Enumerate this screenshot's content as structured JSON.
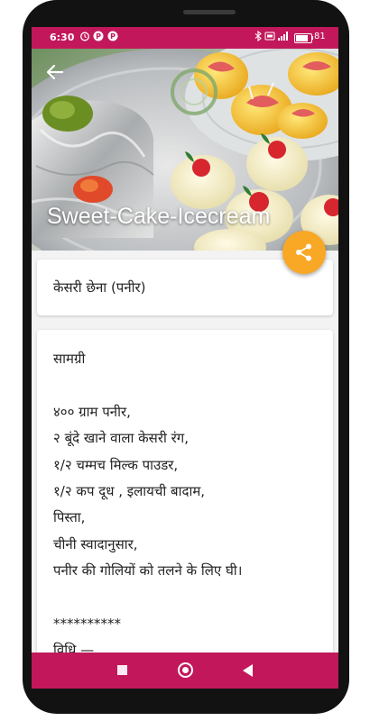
{
  "status_bar": {
    "time": "6:30",
    "icons": [
      "alarm-icon",
      "p-app-icon",
      "p-app-icon",
      "bluetooth-icon",
      "volte-icon",
      "signal-icon",
      "battery-icon"
    ],
    "battery_text": "81",
    "battery_level": 0.81
  },
  "header": {
    "app_title": "Sweet-Cake-Icecream"
  },
  "recipe": {
    "title": "केसरी छेना (पनीर)",
    "lines": [
      "सामग्री",
      "",
      "४०० ग्राम पनीर,",
      "२ बूंदे खाने वाला केसरी रंग,",
      "१/२ चम्मच मिल्क पाउडर,",
      "१/२ कप दूध , इलायची बादाम,",
      "पिस्ता,",
      "चीनी स्वादानुसार,",
      "पनीर की गोलियों को तलने के लिए घी।",
      "",
      "**********",
      "विधि —"
    ]
  },
  "colors": {
    "primary": "#c2185b",
    "fab": "#f9a825",
    "background": "#f3f3f3",
    "card": "#ffffff"
  }
}
